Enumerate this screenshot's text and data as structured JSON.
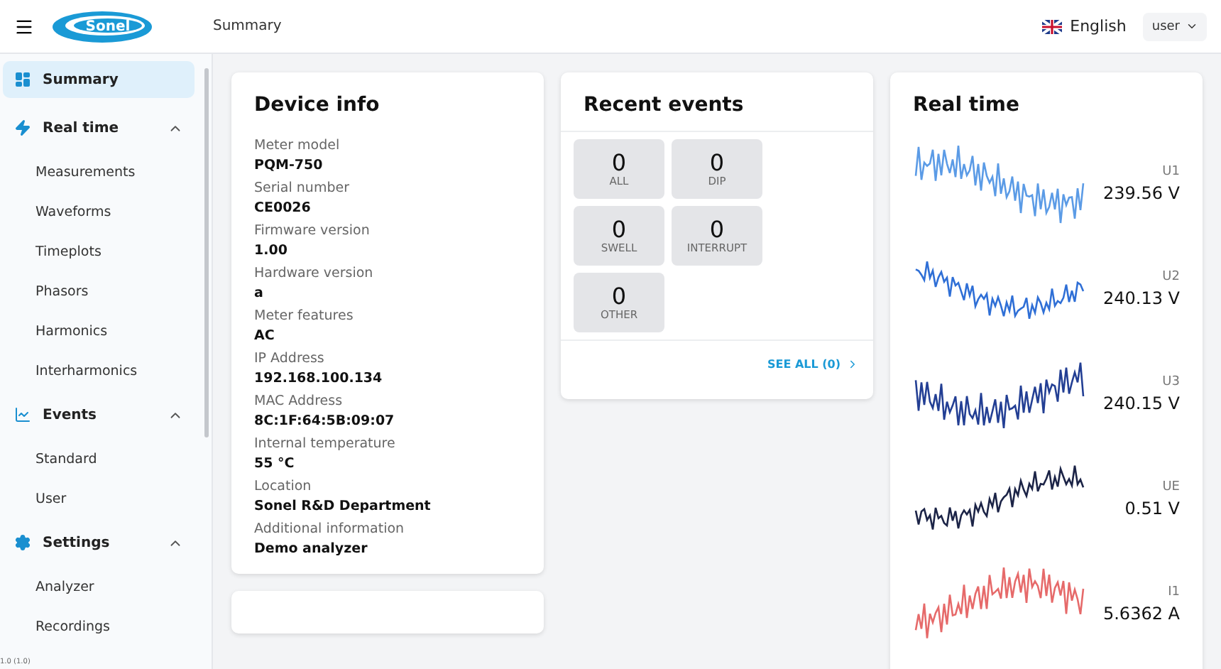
{
  "header": {
    "logo": "Sonel",
    "title": "Summary",
    "language": "English",
    "user": "user"
  },
  "sidebar": {
    "items": [
      {
        "label": "Summary",
        "selected": true
      },
      {
        "label": "Real time",
        "expanded": true,
        "selected": false,
        "children": [
          {
            "label": "Measurements",
            "selected": false
          },
          {
            "label": "Waveforms",
            "selected": false
          },
          {
            "label": "Timeplots",
            "selected": false
          },
          {
            "label": "Phasors",
            "selected": false
          },
          {
            "label": "Harmonics",
            "selected": false
          },
          {
            "label": "Interharmonics",
            "selected": false
          }
        ]
      },
      {
        "label": "Events",
        "expanded": true,
        "selected": false,
        "children": [
          {
            "label": "Standard",
            "selected": false
          },
          {
            "label": "User",
            "selected": false
          }
        ]
      },
      {
        "label": "Settings",
        "expanded": true,
        "selected": false,
        "children": [
          {
            "label": "Analyzer",
            "selected": false
          },
          {
            "label": "Recordings",
            "selected": false
          }
        ]
      }
    ],
    "version": "1.0 (1.0)"
  },
  "device_info": {
    "title": "Device info",
    "fields": [
      {
        "label": "Meter model",
        "value": "PQM-750"
      },
      {
        "label": "Serial number",
        "value": "CE0026"
      },
      {
        "label": "Firmware version",
        "value": "1.00"
      },
      {
        "label": "Hardware version",
        "value": "a"
      },
      {
        "label": "Meter features",
        "value": "AC"
      },
      {
        "label": "IP Address",
        "value": "192.168.100.134"
      },
      {
        "label": "MAC Address",
        "value": "8C:1F:64:5B:09:07"
      },
      {
        "label": "Internal temperature",
        "value": "55 °C"
      },
      {
        "label": "Location",
        "value": "Sonel R&D Department"
      },
      {
        "label": "Additional information",
        "value": "Demo analyzer"
      }
    ]
  },
  "recent_events": {
    "title": "Recent events",
    "tiles": [
      {
        "count": "0",
        "label": "ALL"
      },
      {
        "count": "0",
        "label": "DIP"
      },
      {
        "count": "0",
        "label": "SWELL"
      },
      {
        "count": "0",
        "label": "INTERRUPT"
      },
      {
        "count": "0",
        "label": "OTHER"
      }
    ],
    "see_all": "SEE ALL (0)"
  },
  "real_time": {
    "title": "Real time",
    "channels": [
      {
        "name": "U1",
        "reading": "239.56 V",
        "color": "#5b9be6"
      },
      {
        "name": "U2",
        "reading": "240.13 V",
        "color": "#2f6fd6"
      },
      {
        "name": "U3",
        "reading": "240.15 V",
        "color": "#233f94"
      },
      {
        "name": "UE",
        "reading": "0.51 V",
        "color": "#1c2447"
      },
      {
        "name": "I1",
        "reading": "5.6362 A",
        "color": "#e66a6a"
      }
    ]
  }
}
